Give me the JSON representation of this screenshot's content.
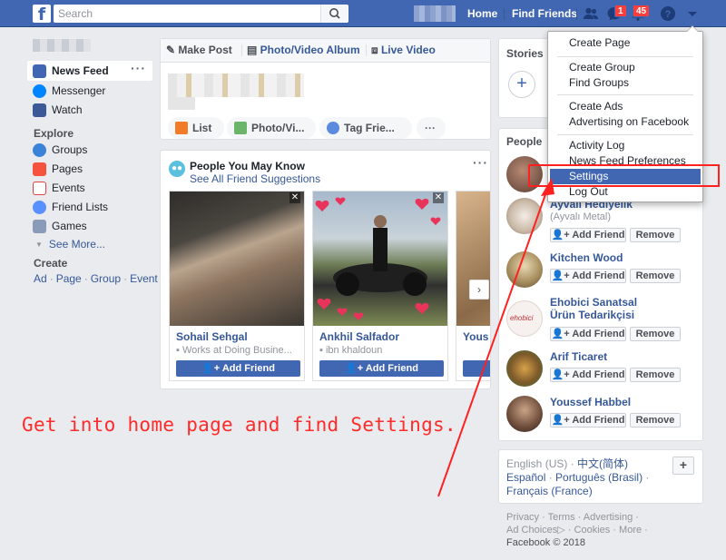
{
  "topbar": {
    "logo": "f",
    "search_placeholder": "Search",
    "home": "Home",
    "find_friends": "Find Friends",
    "messages_badge": "1",
    "notifications_badge": "45"
  },
  "left_nav": {
    "items": [
      {
        "label": "News Feed"
      },
      {
        "label": "Messenger"
      },
      {
        "label": "Watch"
      }
    ],
    "explore_title": "Explore",
    "explore": [
      {
        "label": "Groups"
      },
      {
        "label": "Pages"
      },
      {
        "label": "Events"
      },
      {
        "label": "Friend Lists"
      },
      {
        "label": "Games"
      }
    ],
    "see_more": "See More...",
    "create_title": "Create",
    "create_links": [
      "Ad",
      "Page",
      "Group",
      "Event"
    ]
  },
  "composer": {
    "tabs": [
      "Make Post",
      "Photo/Video Album",
      "Live Video"
    ],
    "actions": [
      "List",
      "Photo/Vi...",
      "Tag Frie..."
    ]
  },
  "pymk": {
    "title": "People You May Know",
    "subtitle": "See All Friend Suggestions",
    "people": [
      {
        "name": "Sohail Sehgal",
        "detail": "Works at Doing Busine...",
        "button": "Add Friend"
      },
      {
        "name": "Ankhil Salfador",
        "detail": "ibn khaldoun",
        "button": "Add Friend"
      },
      {
        "name": "Yous"
      }
    ]
  },
  "stories": {
    "title": "Stories"
  },
  "people_panel": {
    "title": "People",
    "rows": [
      {
        "name": "Ayvali Hediyelik",
        "sub": "(Ayvalı Metal)",
        "add": "Add Friend",
        "remove": "Remove"
      },
      {
        "name": "Kitchen Wood",
        "add": "Add Friend",
        "remove": "Remove"
      },
      {
        "name": "Ehobici Sanatsal",
        "name2": "Ürün Tedarikçisi",
        "add": "Add Friend",
        "remove": "Remove"
      },
      {
        "name": "Arif Ticaret",
        "add": "Add Friend",
        "remove": "Remove"
      },
      {
        "name": "Youssef Habbel",
        "add": "Add Friend",
        "remove": "Remove"
      }
    ]
  },
  "languages": {
    "current": "English (US)",
    "others": [
      "中文(简体)",
      "Español",
      "Português (Brasil)",
      "Français (France)"
    ]
  },
  "footer": {
    "links": [
      "Privacy",
      "Terms",
      "Advertising",
      "Ad Choices",
      "Cookies",
      "More"
    ],
    "copyright": "Facebook © 2018"
  },
  "dropdown": {
    "items": [
      "Create Page",
      "Create Group",
      "Find Groups",
      "Create Ads",
      "Advertising on Facebook",
      "Activity Log",
      "News Feed Preferences",
      "Settings",
      "Log Out"
    ],
    "highlighted": "Settings"
  },
  "annotation": {
    "text": "Get into home page and find Settings.",
    "color": "#ff2a2a"
  },
  "colors": {
    "brand": "#4267b2",
    "link": "#365899",
    "annotation_red": "#ff2020"
  }
}
